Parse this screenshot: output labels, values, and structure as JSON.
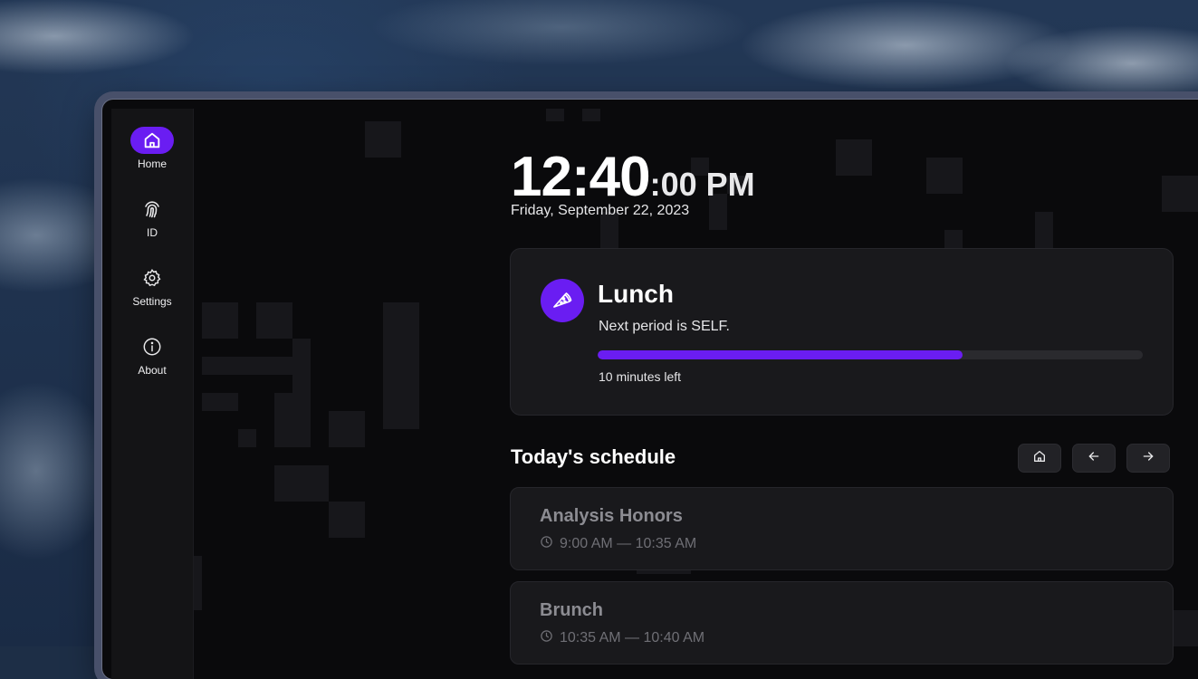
{
  "sidebar": {
    "items": [
      {
        "label": "Home",
        "icon": "home-icon",
        "active": true
      },
      {
        "label": "ID",
        "icon": "fingerprint-icon",
        "active": false
      },
      {
        "label": "Settings",
        "icon": "gear-icon",
        "active": false
      },
      {
        "label": "About",
        "icon": "info-icon",
        "active": false
      }
    ]
  },
  "clock": {
    "hours_minutes": "12:40",
    "seconds_period": ":00 PM",
    "date": "Friday, September 22, 2023"
  },
  "current_period": {
    "name": "Lunch",
    "icon": "pizza-icon",
    "next_text": "Next period is SELF.",
    "progress_percent": 67,
    "time_left": "10 minutes left"
  },
  "schedule": {
    "title": "Today's schedule",
    "buttons": [
      "home-icon",
      "arrow-left-icon",
      "arrow-right-icon"
    ],
    "classes": [
      {
        "name": "Analysis Honors",
        "time": "9:00 AM — 10:35 AM"
      },
      {
        "name": "Brunch",
        "time": "10:35 AM — 10:40 AM"
      }
    ]
  },
  "colors": {
    "accent": "#6a1df2",
    "background": "#0a0a0c",
    "card": "#19191c"
  }
}
